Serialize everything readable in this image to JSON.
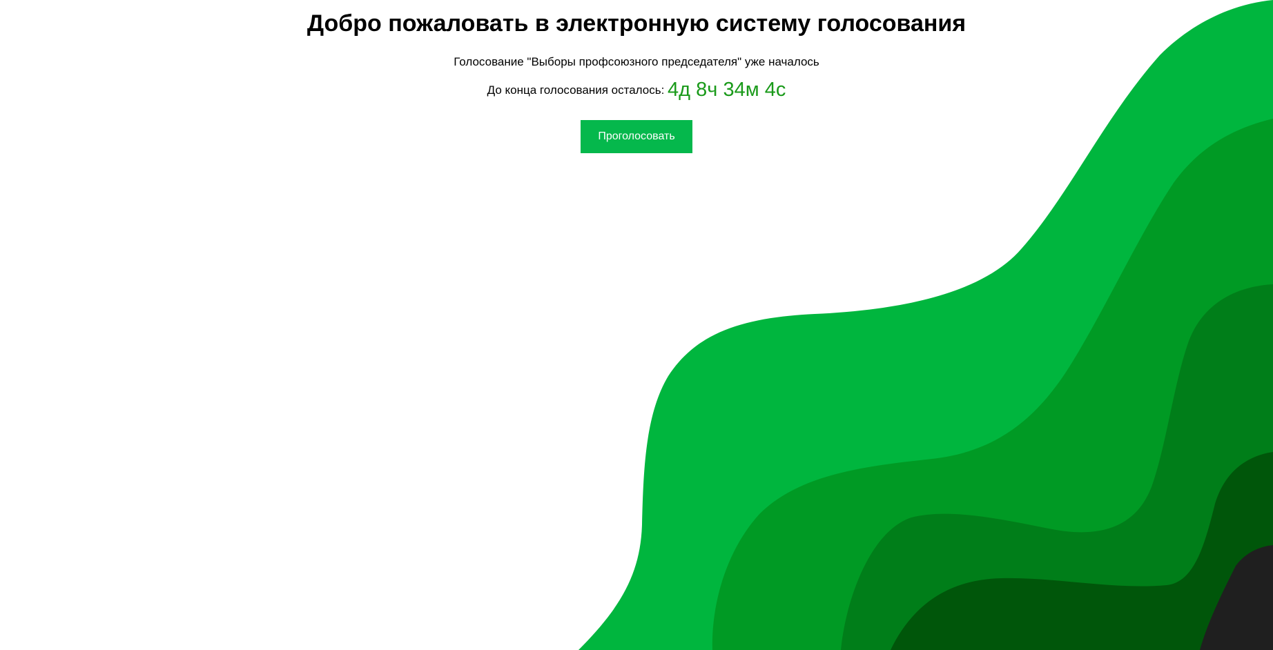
{
  "page": {
    "title": "Добро пожаловать в электронную систему голосования",
    "subtitle": "Голосование \"Выборы профсоюзного председателя\" уже началось",
    "countdown_label": "До конца голосования осталось:",
    "countdown_value": "4д 8ч 34м 4с",
    "vote_button_label": "Проголосовать"
  },
  "colors": {
    "countdown": "#1a9a1a",
    "button": "#05b84c",
    "wave_1": "#00b63e",
    "wave_2": "#009a24",
    "wave_3": "#007e19",
    "wave_4": "#00560a",
    "wave_5": "#1f1f1f"
  }
}
